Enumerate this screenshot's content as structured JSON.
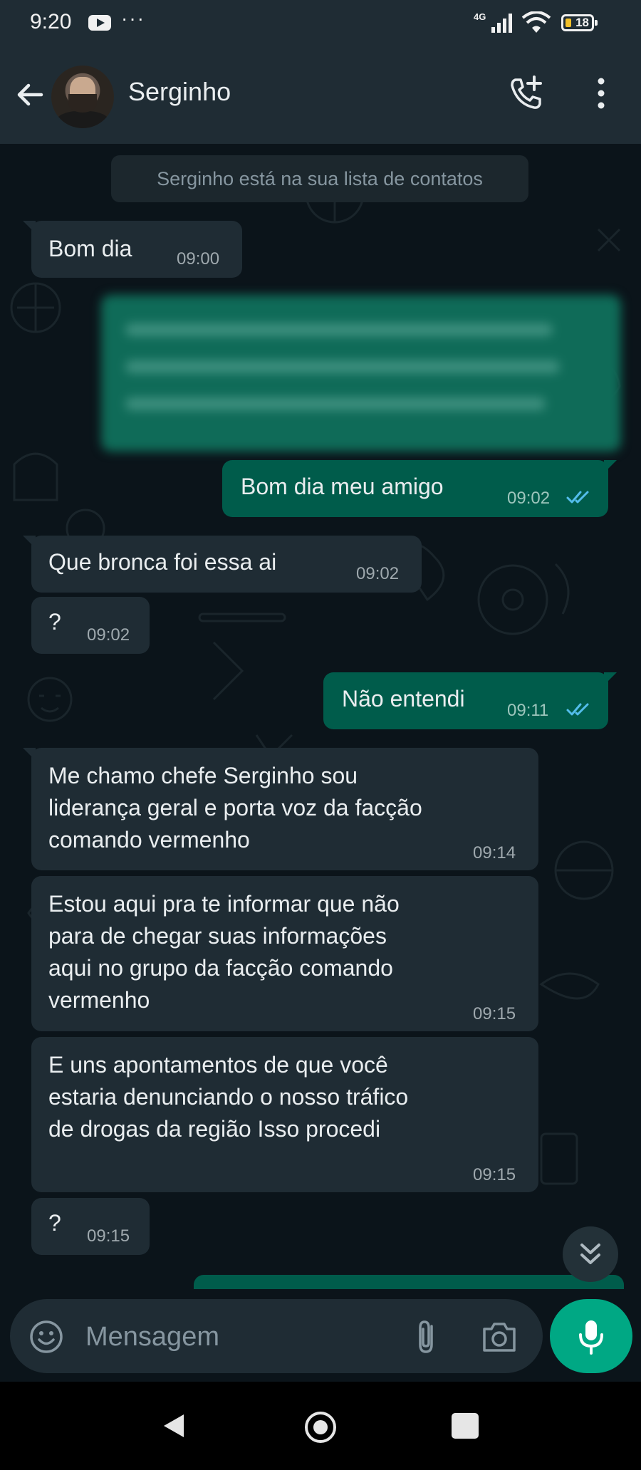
{
  "status_bar": {
    "time": "9:20",
    "dots": "···",
    "network": "4G",
    "battery": "18"
  },
  "header": {
    "contact_name": "Serginho"
  },
  "chat": {
    "system_message": "Serginho está na sua lista de contatos",
    "messages": [
      {
        "direction": "in",
        "text": "Bom dia",
        "time": "09:00"
      },
      {
        "direction": "out",
        "text": "Bom dia meu amigo",
        "time": "09:02",
        "read": true
      },
      {
        "direction": "in",
        "text": "Que bronca foi essa ai",
        "time": "09:02"
      },
      {
        "direction": "in",
        "text": "?",
        "time": "09:02"
      },
      {
        "direction": "out",
        "text": "Não entendi",
        "time": "09:11",
        "read": true
      },
      {
        "direction": "in",
        "lines": [
          "Me chamo chefe Serginho sou",
          "liderança geral e porta voz da facção",
          "comando vermenho"
        ],
        "time": "09:14"
      },
      {
        "direction": "in",
        "lines": [
          "Estou aqui pra te informar que não",
          "para de chegar suas informações",
          "aqui no grupo da facção comando",
          "vermenho"
        ],
        "time": "09:15"
      },
      {
        "direction": "in",
        "lines": [
          "E uns apontamentos de que você",
          "estaria denunciando o nosso tráfico",
          "de drogas da região Isso procedi"
        ],
        "time": "09:15"
      },
      {
        "direction": "in",
        "text": "?",
        "time": "09:15"
      }
    ]
  },
  "input": {
    "placeholder": "Mensagem"
  },
  "colors": {
    "background": "#0b141a",
    "bar": "#1f2c34",
    "incoming": "#1f2c34",
    "outgoing": "#005c4b",
    "accent": "#00a884",
    "read_ticks": "#53bdeb"
  },
  "icons": [
    "back-arrow-icon",
    "call-add-icon",
    "menu-icon",
    "double-tick-icon",
    "chevron-double-down-icon",
    "emoji-icon",
    "attach-icon",
    "camera-icon",
    "mic-icon",
    "nav-back-icon",
    "nav-home-icon",
    "nav-recent-icon"
  ]
}
